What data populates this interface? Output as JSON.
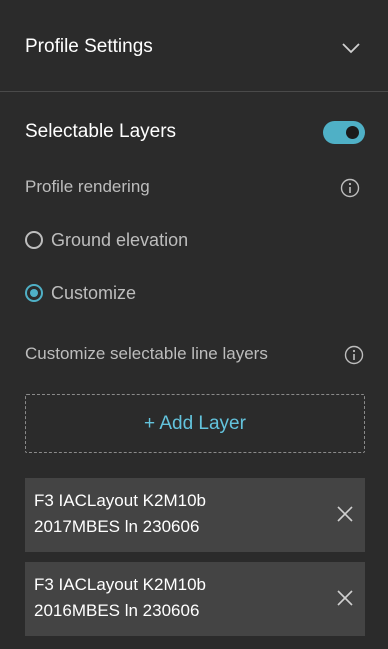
{
  "header": {
    "title": "Profile Settings",
    "collapse_icon": "chevron-down-icon"
  },
  "selectable_layers": {
    "title": "Selectable Layers",
    "toggle_on": true,
    "accent_color": "#4fb0c6"
  },
  "profile_rendering": {
    "label": "Profile rendering",
    "options": [
      {
        "label": "Ground elevation",
        "selected": false
      },
      {
        "label": "Customize",
        "selected": true
      }
    ]
  },
  "customize": {
    "label": "Customize selectable line layers",
    "add_button": "+ Add Layer"
  },
  "layers": [
    {
      "line1": "F3 IACLayout K2M10b",
      "line2": "2017MBES ln 230606"
    },
    {
      "line1": "F3 IACLayout K2M10b",
      "line2": "2016MBES ln 230606"
    }
  ]
}
